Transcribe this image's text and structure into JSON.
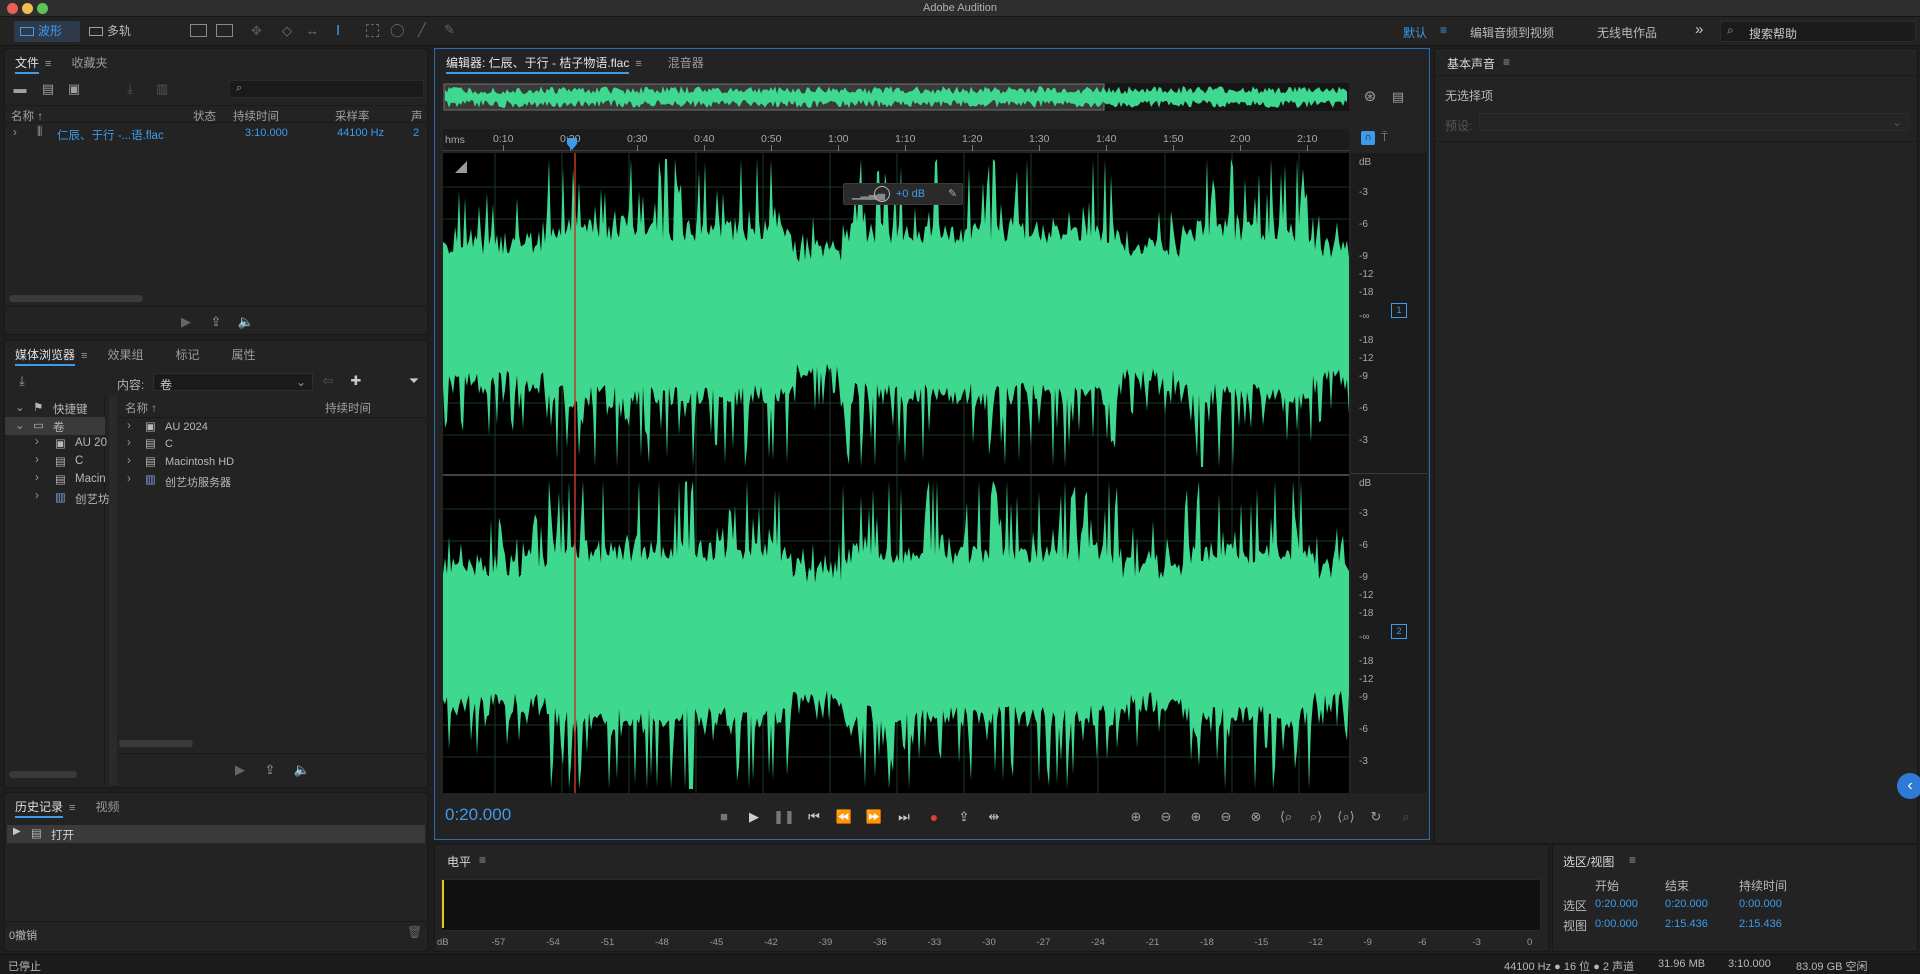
{
  "window": {
    "title": "Adobe Audition"
  },
  "topbar": {
    "mode_waveform": "波形",
    "mode_multitrack": "多轨",
    "workspaces": [
      "默认",
      "编辑音频到视频",
      "无线电作品"
    ],
    "more": "»",
    "search_placeholder": "搜索帮助"
  },
  "files_panel": {
    "tabs": [
      "文件",
      "收藏夹"
    ],
    "columns": [
      "名称 ↑",
      "状态",
      "持续时间",
      "采样率",
      "声"
    ],
    "files": [
      {
        "name": "仁辰、于行 -...语.flac",
        "duration": "3:10.000",
        "sample_rate": "44100 Hz",
        "channels": "2"
      }
    ]
  },
  "media_browser": {
    "tabs": [
      "媒体浏览器",
      "效果组",
      "标记",
      "属性"
    ],
    "content_label": "内容:",
    "content_value": "卷",
    "tree": [
      "快捷键",
      "卷",
      "AU 20",
      "C",
      "Macin",
      "创艺坊"
    ],
    "columns": [
      "名称 ↑",
      "持续时间"
    ],
    "items": [
      "AU 2024",
      "C",
      "Macintosh HD",
      "创艺坊服务器"
    ]
  },
  "history_panel": {
    "tabs": [
      "历史记录",
      "视频"
    ],
    "items": [
      "打开"
    ],
    "undo_count": "0撤销"
  },
  "status": {
    "left": "已停止",
    "sample_info": "44100 Hz ● 16 位 ● 2 声道",
    "size": "31.96 MB",
    "duration": "3:10.000",
    "free": "83.09 GB 空闲"
  },
  "editor": {
    "tab_title": "编辑器: 仁辰、于行 - 桔子物语.flac",
    "tab_mixer": "混音器",
    "time_ruler_unit": "hms",
    "ruler_ticks": [
      "0:10",
      "0:20",
      "0:30",
      "0:40",
      "0:50",
      "1:00",
      "1:10",
      "1:20",
      "1:30",
      "1:40",
      "1:50",
      "2:00",
      "2:10"
    ],
    "db_labels_top": [
      "dB",
      "-3",
      "-6",
      "-9",
      "-12",
      "-18",
      "-∞",
      "-18",
      "-12",
      "-9",
      "-6",
      "-3"
    ],
    "db_labels_bottom": [
      "dB",
      "-3",
      "-6",
      "-9",
      "-12",
      "-18",
      "-∞",
      "-18",
      "-12",
      "-9",
      "-6",
      "-3"
    ],
    "channel_1": "1",
    "channel_2": "2",
    "hud_gain": "+0 dB",
    "current_time": "0:20.000",
    "waveform_color": "#3ed88e",
    "playhead_color": "#c0392b"
  },
  "levels_panel": {
    "title": "电平",
    "scale": [
      "dB",
      "-57",
      "-54",
      "-51",
      "-48",
      "-45",
      "-42",
      "-39",
      "-36",
      "-33",
      "-30",
      "-27",
      "-24",
      "-21",
      "-18",
      "-15",
      "-12",
      "-9",
      "-6",
      "-3",
      "0"
    ]
  },
  "essential_sound": {
    "title": "基本声音",
    "no_selection": "无选择项",
    "preset_label": "预设:"
  },
  "selection_view": {
    "title": "选区/视图",
    "headers": [
      "开始",
      "结束",
      "持续时间"
    ],
    "rows": [
      {
        "label": "选区",
        "start": "0:20.000",
        "end": "0:20.000",
        "duration": "0:00.000"
      },
      {
        "label": "视图",
        "start": "0:00.000",
        "end": "2:15.436",
        "duration": "2:15.436"
      }
    ]
  }
}
